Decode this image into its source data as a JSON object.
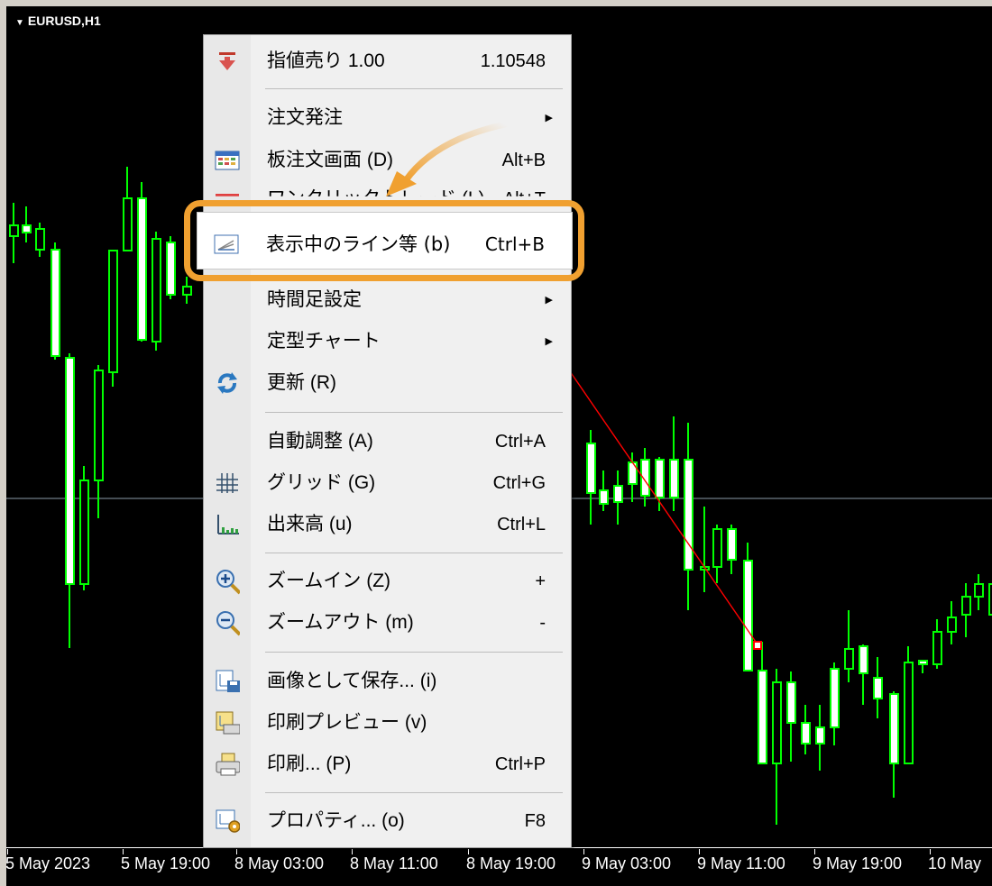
{
  "chart": {
    "symbol": "EURUSD,H1"
  },
  "menu": {
    "items": [
      {
        "label": "指値売り 1.00",
        "shortcut": "1.10548",
        "icon": "sell-limit-icon",
        "submenu": false
      },
      {
        "label": "注文発注",
        "shortcut": "",
        "icon": "",
        "submenu": true
      },
      {
        "label": "板注文画面 (D)",
        "shortcut": "Alt+B",
        "icon": "depth-of-market-icon",
        "submenu": false
      },
      {
        "label": "ワンクリックトレード (L)",
        "shortcut": "Alt+T",
        "icon": "one-click-trading-icon",
        "submenu": false
      },
      {
        "label": "表示中のライン等 (b)",
        "shortcut": "Ctrl+B",
        "icon": "objects-list-icon",
        "submenu": false
      },
      {
        "label": "時間足設定",
        "shortcut": "",
        "icon": "",
        "submenu": true
      },
      {
        "label": "定型チャート",
        "shortcut": "",
        "icon": "",
        "submenu": true
      },
      {
        "label": "更新 (R)",
        "shortcut": "",
        "icon": "refresh-icon",
        "submenu": false
      },
      {
        "label": "自動調整 (A)",
        "shortcut": "Ctrl+A",
        "icon": "",
        "submenu": false
      },
      {
        "label": "グリッド (G)",
        "shortcut": "Ctrl+G",
        "icon": "grid-icon",
        "submenu": false
      },
      {
        "label": "出来高 (u)",
        "shortcut": "Ctrl+L",
        "icon": "volume-icon",
        "submenu": false
      },
      {
        "label": "ズームイン (Z)",
        "shortcut": "+",
        "icon": "zoom-in-icon",
        "submenu": false
      },
      {
        "label": "ズームアウト (m)",
        "shortcut": "-",
        "icon": "zoom-out-icon",
        "submenu": false
      },
      {
        "label": "画像として保存... (i)",
        "shortcut": "",
        "icon": "save-image-icon",
        "submenu": false
      },
      {
        "label": "印刷プレビュー (v)",
        "shortcut": "",
        "icon": "print-preview-icon",
        "submenu": false
      },
      {
        "label": "印刷... (P)",
        "shortcut": "Ctrl+P",
        "icon": "printer-icon",
        "submenu": false
      },
      {
        "label": "プロパティ... (o)",
        "shortcut": "F8",
        "icon": "properties-icon",
        "submenu": false
      }
    ]
  },
  "axis": {
    "labels": [
      "5 May 2023",
      "5 May 19:00",
      "8 May 03:00",
      "8 May 11:00",
      "8 May 19:00",
      "9 May 03:00",
      "9 May 11:00",
      "9 May 19:00",
      "10 May"
    ]
  },
  "colors": {
    "candle": "#00ff00",
    "background": "#000000",
    "trendline": "#ff0000",
    "highlight": "#f0a030"
  }
}
